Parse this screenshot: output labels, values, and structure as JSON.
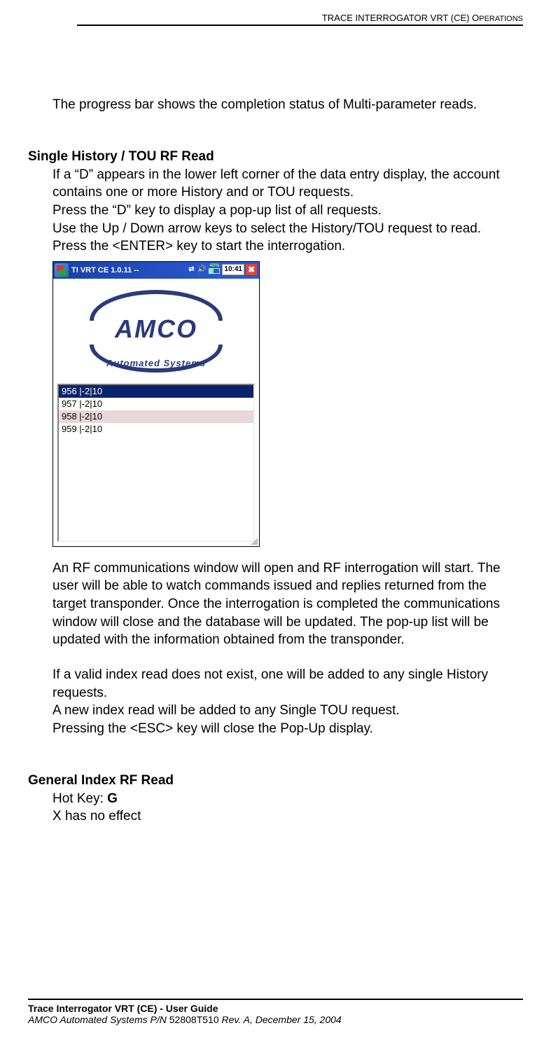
{
  "header": {
    "running_title_caps": "TRACE INTERROGATOR VRT (CE) O",
    "running_title_small": "PERATIONS"
  },
  "intro_para": "The progress bar shows the completion status of Multi-parameter reads.",
  "section1": {
    "heading": "Single History / TOU RF Read",
    "p1": "If a “D” appears in the lower left corner of the data entry display, the account contains one or more History and or TOU requests.",
    "p2": "Press the “D” key to display a pop-up list of all requests.",
    "p3": "Use the Up / Down arrow keys to select the History/TOU request to read.",
    "p4": "Press the <ENTER> key to start the interrogation.",
    "after1": "An RF communications window will open and RF interrogation will start. The user will be able to watch commands issued and replies returned from the target transponder. Once the interrogation is completed the communications window will close and the database will be updated. The pop-up list will be updated with the information obtained from the transponder.",
    "after2": "If a valid index read does not exist, one will be added to any single History requests.",
    "after3": "A new index read will be added to any Single TOU request.",
    "after4": "Pressing the <ESC> key will close the Pop-Up display."
  },
  "section2": {
    "heading": "General Index RF Read",
    "hotkey_label": "Hot Key: ",
    "hotkey_value": "G",
    "p2": "X has no effect"
  },
  "screenshot": {
    "title": "TI VRT CE 1.0.11 --",
    "battery_pct": "40%",
    "clock": "10:41",
    "close_glyph": "✖",
    "speaker_glyph": "🔊",
    "conn_glyph": "⇄",
    "logo_main": "AMCO",
    "logo_sub": "Automated Systems",
    "list": [
      "956 |-2|10",
      "957 |-2|10",
      "958 |-2|10",
      "959 |-2|10"
    ]
  },
  "footer": {
    "line1_bold": "Trace Interrogator VRT (CE) - User Guide",
    "line2_italic_a": "AMCO Automated Systems P/N ",
    "line2_normal": "52808T510 ",
    "line2_italic_b": "Rev. A, December 15, 2004"
  }
}
